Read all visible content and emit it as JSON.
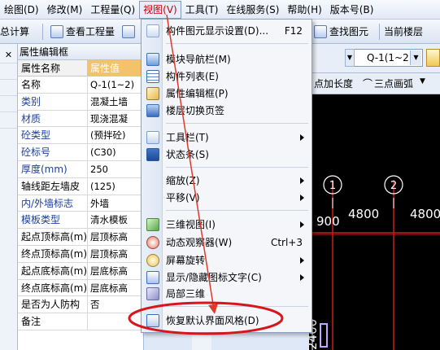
{
  "menubar": {
    "items": [
      "绘图(D)",
      "修改(M)",
      "工程量(Q)",
      "视图(V)",
      "工具(T)",
      "在线服务(S)",
      "帮助(H)",
      "版本号(B)"
    ]
  },
  "toolbar": {
    "left_cut": "总计算",
    "view_quantity": "查看工程量",
    "find_element": "查找图元",
    "current_floor": "当前楼层"
  },
  "panel": {
    "title": "属性编辑框",
    "col_name": "属性名称",
    "col_value": "属性值",
    "rows": [
      {
        "k": "名称",
        "v": "Q-1(1~2)"
      },
      {
        "k": "类别",
        "v": "混凝土墙"
      },
      {
        "k": "材质",
        "v": "现浇混凝"
      },
      {
        "k": "砼类型",
        "v": "(预拌砼)"
      },
      {
        "k": "砼标号",
        "v": "(C30)"
      },
      {
        "k": "厚度(mm)",
        "v": "250"
      },
      {
        "k": "轴线距左墙皮",
        "v": "(125)"
      },
      {
        "k": "内/外墙标志",
        "v": "外墙"
      },
      {
        "k": "模板类型",
        "v": "清水模板"
      },
      {
        "k": "起点顶标高(m)",
        "v": "层顶标高"
      },
      {
        "k": "终点顶标高(m)",
        "v": "层顶标高"
      },
      {
        "k": "起点底标高(m)",
        "v": "层底标高"
      },
      {
        "k": "终点底标高(m)",
        "v": "层底标高"
      },
      {
        "k": "是否为人防构",
        "v": "否"
      },
      {
        "k": "备注",
        "v": ""
      }
    ]
  },
  "right": {
    "dropdown_value": "Q-1(1~2",
    "tool_a": "点加长度",
    "tool_b": "三点画弧",
    "axis_1": "1",
    "axis_2": "2",
    "dim_900": "900",
    "dim_4800a": "4800",
    "dim_4800b": "4800",
    "dim_2400": "2400"
  },
  "dropdown": {
    "items": [
      {
        "label": "构件图元显示设置(D)...",
        "shortcut": "F12"
      },
      {
        "label": "模块导航栏(M)"
      },
      {
        "label": "构件列表(E)"
      },
      {
        "label": "属性编辑框(P)"
      },
      {
        "label": "楼层切换页签"
      },
      {
        "label": "工具栏(T)"
      },
      {
        "label": "状态条(S)"
      },
      {
        "label": "缩放(Z)"
      },
      {
        "label": "平移(V)"
      },
      {
        "label": "三维视图(I)"
      },
      {
        "label": "动态观察器(W)",
        "shortcut": "Ctrl+3"
      },
      {
        "label": "屏幕旋转"
      },
      {
        "label": "显示/隐藏图标文字(C)"
      },
      {
        "label": "局部三维"
      },
      {
        "label": "恢复默认界面风格(D)"
      }
    ]
  },
  "colors": {
    "highlight_ellipse": "#d8151b",
    "arrow": "#e03a2a",
    "canvas": "#000000",
    "grid_red": "#c81c1c"
  }
}
